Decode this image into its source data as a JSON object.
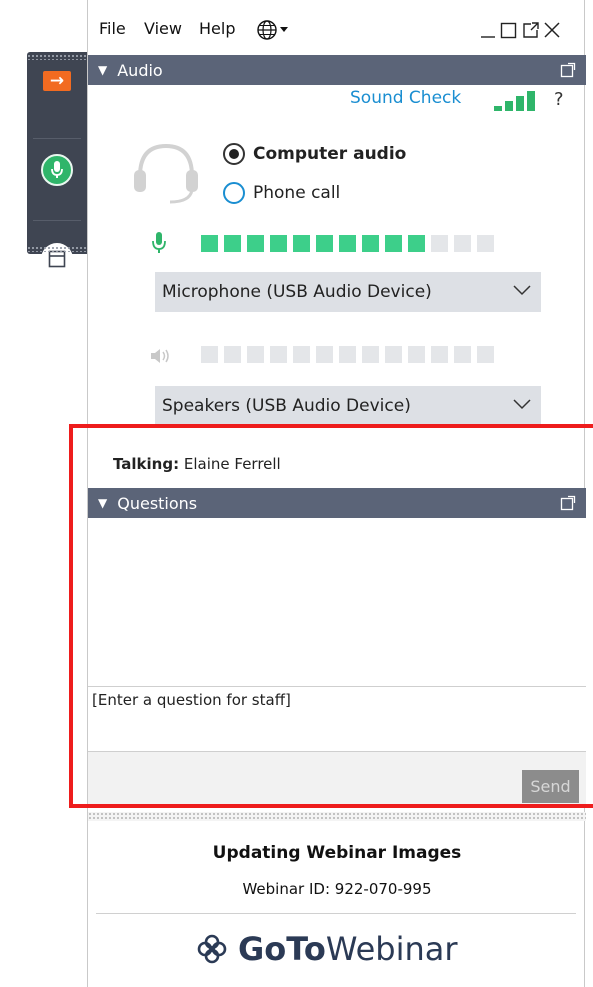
{
  "menu": {
    "file": "File",
    "view": "View",
    "help": "Help"
  },
  "window_controls": [
    "minimize-icon",
    "maximize-icon",
    "popout-icon",
    "close-icon"
  ],
  "left_tab": {
    "icons": [
      "exit-arrow-icon",
      "microphone-icon",
      "panel-icon"
    ],
    "accent_exit": "#f26b21",
    "accent_mic": "#2fb56a"
  },
  "audio": {
    "header": "Audio",
    "sound_check": "Sound Check",
    "help": "?",
    "options": [
      {
        "label": "Computer audio",
        "selected": true
      },
      {
        "label": "Phone call",
        "selected": false
      }
    ],
    "mic_level": {
      "lit": 10,
      "total": 13
    },
    "speaker_level": {
      "lit": 0,
      "total": 13
    },
    "microphone_device": "Microphone (USB Audio Device)",
    "speaker_device": "Speakers (USB Audio Device)"
  },
  "talking": {
    "label": "Talking:",
    "name": "Elaine Ferrell"
  },
  "questions": {
    "header": "Questions",
    "placeholder": "[Enter a question for staff]",
    "send": "Send"
  },
  "webinar": {
    "title": "Updating Webinar Images",
    "id_text": "Webinar ID: 922-070-995"
  },
  "brand": {
    "goto": "GoTo",
    "webinar": "Webinar",
    "color": "#2b3a55"
  },
  "highlight_color": "#ee1c1c"
}
